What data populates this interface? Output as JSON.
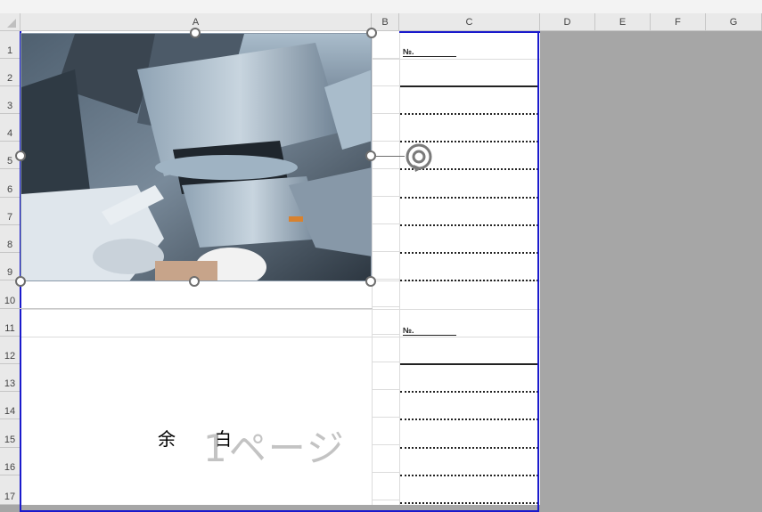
{
  "columns": [
    "A",
    "B",
    "C",
    "D",
    "E",
    "F",
    "G"
  ],
  "rows": [
    "1",
    "2",
    "3",
    "4",
    "5",
    "6",
    "7",
    "8",
    "9",
    "10",
    "11",
    "12",
    "13",
    "14",
    "15",
    "16",
    "17"
  ],
  "cells": {
    "c1_label": "№.",
    "c11_label": "№."
  },
  "watermark": {
    "yohaku_1": "余",
    "yohaku_2": "白",
    "page": "1ページ"
  },
  "image": {
    "alt_icon": "construction-worker-ductwork-photo"
  },
  "colors": {
    "page_border": "#1a1acc",
    "outside_area": "#a6a6a6"
  }
}
